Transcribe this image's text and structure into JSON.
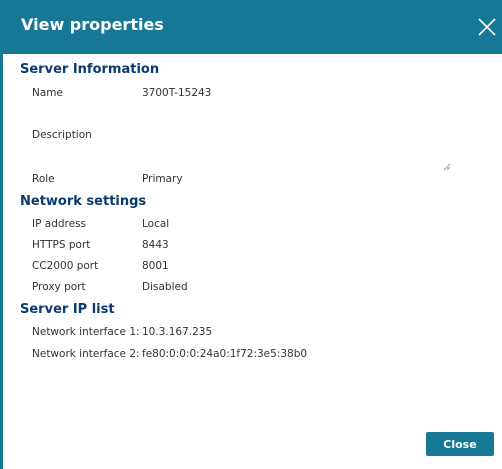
{
  "dialog": {
    "title": "View properties",
    "close_button": "Close"
  },
  "server_information": {
    "heading": "Server Information",
    "rows": [
      {
        "label": "Name",
        "value": "3700T-15243"
      },
      {
        "label": "Description",
        "value": ""
      },
      {
        "label": "Role",
        "value": "Primary"
      }
    ]
  },
  "network_settings": {
    "heading": "Network settings",
    "rows": [
      {
        "label": "IP address",
        "value": "Local"
      },
      {
        "label": "HTTPS port",
        "value": "8443"
      },
      {
        "label": "CC2000 port",
        "value": "8001"
      },
      {
        "label": "Proxy port",
        "value": "Disabled"
      }
    ]
  },
  "server_ip_list": {
    "heading": "Server IP list",
    "rows": [
      {
        "label": "Network interface 1:",
        "value": "10.3.167.235"
      },
      {
        "label": "Network interface 2:",
        "value": "fe80:0:0:0:24a0:1f72:3e5:38b0"
      }
    ]
  },
  "colors": {
    "accent": "#167895",
    "heading": "#0b3b6e",
    "text": "#333333"
  }
}
